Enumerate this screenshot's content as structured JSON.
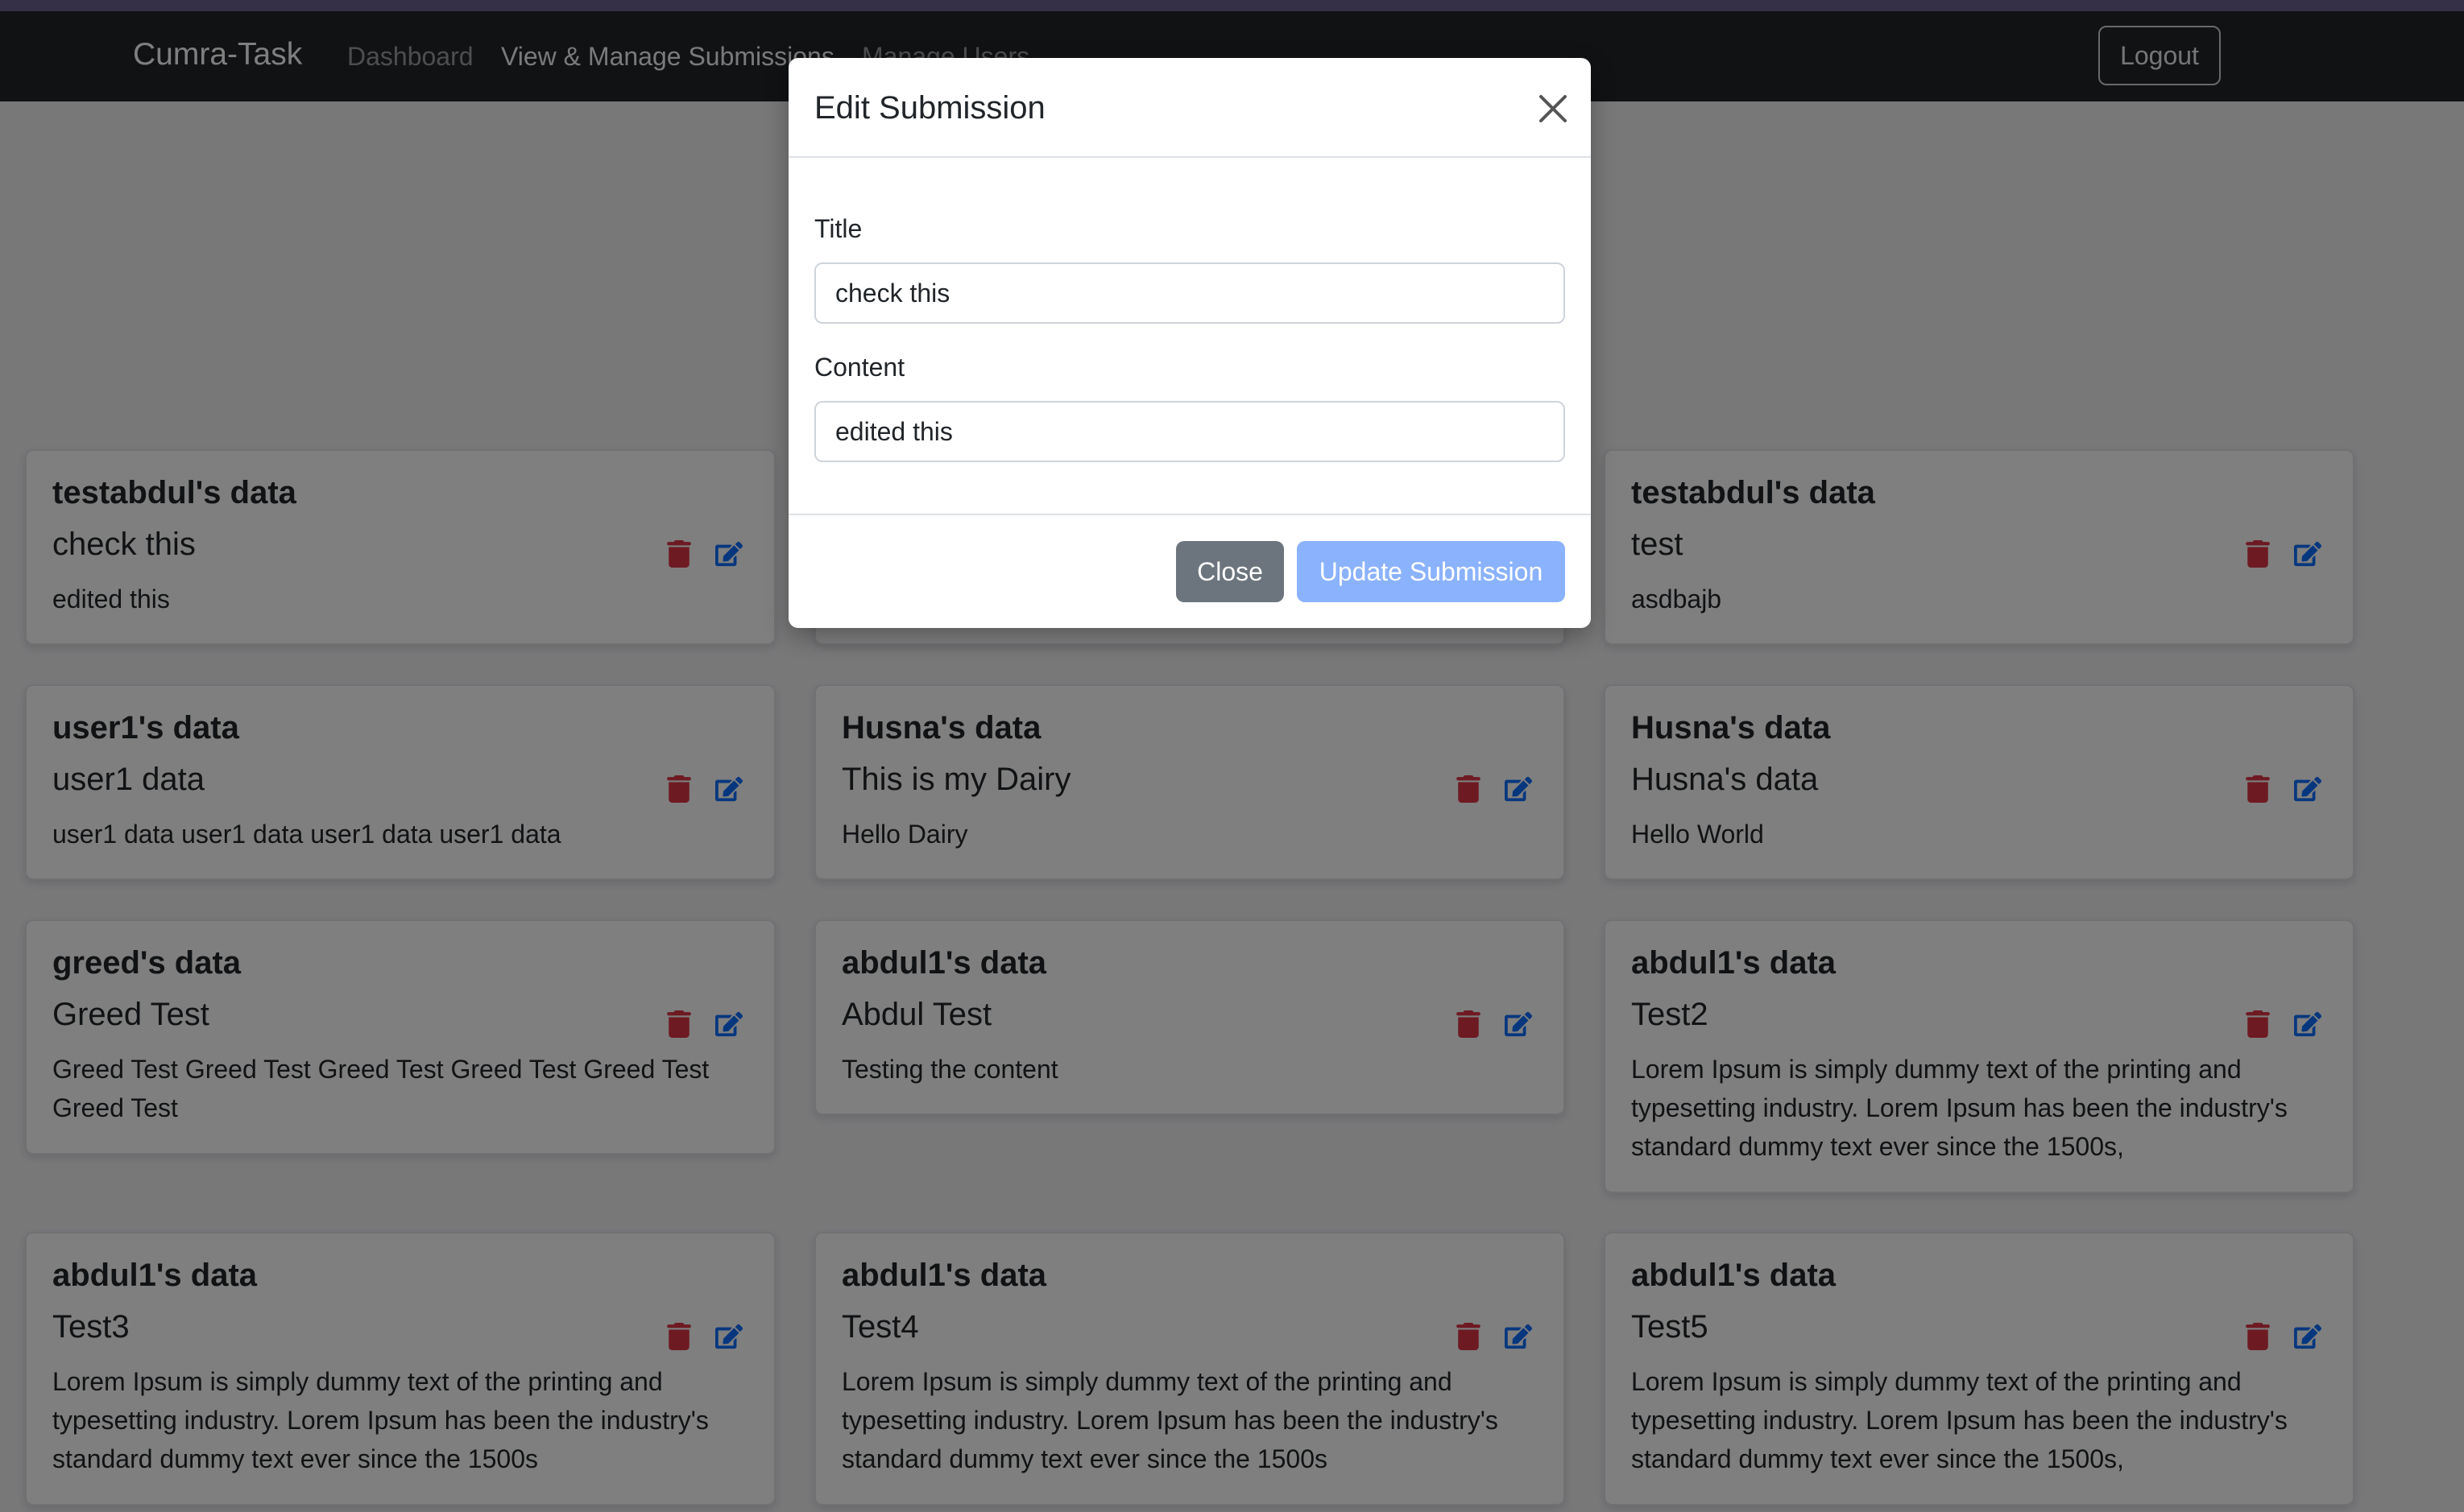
{
  "colors": {
    "navbar_bg": "#212529",
    "accent_strip": "#6b5e91",
    "delete_icon": "#dc3545",
    "edit_icon": "#0d6efd",
    "close_button": "#6c757d",
    "update_button": "#8bb2fd"
  },
  "navbar": {
    "brand": "Cumra-Task",
    "links": [
      "Dashboard",
      "View & Manage Submissions",
      "Manage Users"
    ],
    "logout_label": "Logout"
  },
  "cards": [
    {
      "owner": "testabdul's data",
      "title": "check this",
      "content": "edited this",
      "icons": [
        "trash-icon",
        "edit-icon"
      ]
    },
    {
      "owner": "testabdul's data",
      "title": "test",
      "content": "asdbajb",
      "icons": [
        "trash-icon",
        "edit-icon"
      ]
    },
    {
      "owner": "user1's data",
      "title": "user1 data",
      "content": "user1 data user1 data user1 data user1 data",
      "icons": [
        "trash-icon",
        "edit-icon"
      ]
    },
    {
      "owner": "Husna's data",
      "title": "This is my Dairy",
      "content": "Hello Dairy",
      "icons": [
        "trash-icon",
        "edit-icon"
      ]
    },
    {
      "owner": "Husna's data",
      "title": "Husna's data",
      "content": "Hello World",
      "icons": [
        "trash-icon",
        "edit-icon"
      ]
    },
    {
      "owner": "greed's data",
      "title": "Greed Test",
      "content": "Greed Test Greed Test Greed Test Greed Test Greed Test Greed Test",
      "icons": [
        "trash-icon",
        "edit-icon"
      ]
    },
    {
      "owner": "abdul1's data",
      "title": "Abdul Test",
      "content": "Testing the content",
      "icons": [
        "trash-icon",
        "edit-icon"
      ]
    },
    {
      "owner": "abdul1's data",
      "title": "Test2",
      "content": "Lorem Ipsum is simply dummy text of the printing and typesetting industry. Lorem Ipsum has been the industry's standard dummy text ever since the 1500s,",
      "icons": [
        "trash-icon",
        "edit-icon"
      ]
    },
    {
      "owner": "abdul1's data",
      "title": "Test3",
      "content": "Lorem Ipsum is simply dummy text of the printing and typesetting industry. Lorem Ipsum has been the industry's standard dummy text ever since the 1500s",
      "icons": [
        "trash-icon",
        "edit-icon"
      ]
    },
    {
      "owner": "abdul1's data",
      "title": "Test4",
      "content": "Lorem Ipsum is simply dummy text of the printing and typesetting industry. Lorem Ipsum has been the industry's standard dummy text ever since the 1500s",
      "icons": [
        "trash-icon",
        "edit-icon"
      ]
    },
    {
      "owner": "abdul1's data",
      "title": "Test5",
      "content": "Lorem Ipsum is simply dummy text of the printing and typesetting industry. Lorem Ipsum has been the industry's standard dummy text ever since the 1500s,",
      "icons": [
        "trash-icon",
        "edit-icon"
      ]
    }
  ],
  "modal": {
    "title": "Edit Submission",
    "close_icon": "close-icon",
    "fields": [
      {
        "label": "Title",
        "value": "check this"
      },
      {
        "label": "Content",
        "value": "edited this"
      }
    ],
    "close_label": "Close",
    "update_label": "Update Submission"
  }
}
